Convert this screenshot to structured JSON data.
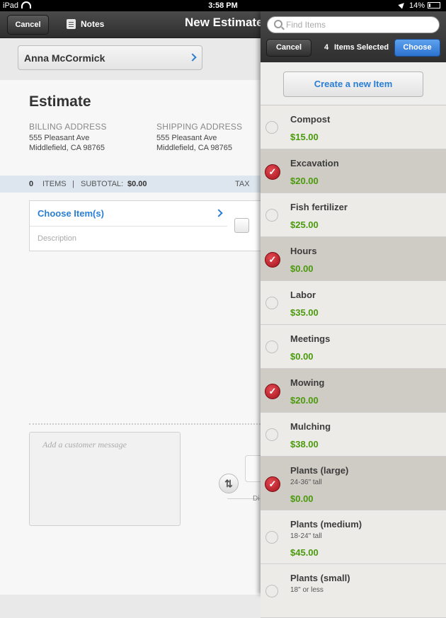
{
  "status": {
    "device": "iPad",
    "time": "3:58 PM",
    "battery": "14%"
  },
  "topbar": {
    "cancel_label": "Cancel",
    "notes_label": "Notes",
    "title": "New Estimate"
  },
  "customer": {
    "name": "Anna McCormick"
  },
  "estimate": {
    "title": "Estimate",
    "billing_label": "BILLING ADDRESS",
    "billing_line1": "555 Pleasant Ave",
    "billing_line2": "Middlefield, CA 98765",
    "shipping_label": "SHIPPING ADDRESS",
    "shipping_line1": "555 Pleasant Ave",
    "shipping_line2": "Middlefield, CA 98765"
  },
  "summary": {
    "item_count": "0",
    "items_label": "ITEMS",
    "separator": "|",
    "subtotal_label": "SUBTOTAL:",
    "subtotal_value": "$0.00",
    "tax_label": "TAX"
  },
  "line_item": {
    "choose_label": "Choose Item(s)",
    "description_placeholder": "Description"
  },
  "message": {
    "placeholder": "Add a customer message"
  },
  "partial_label": "Di",
  "picker": {
    "search_placeholder": "Find Items",
    "cancel_label": "Cancel",
    "selected_count": "4",
    "selected_label": "Items Selected",
    "choose_label": "Choose",
    "create_label": "Create a new Item",
    "items": [
      {
        "name": "Compost",
        "price": "$15.00",
        "selected": false
      },
      {
        "name": "Excavation",
        "price": "$20.00",
        "selected": true
      },
      {
        "name": "Fish fertilizer",
        "price": "$25.00",
        "selected": false
      },
      {
        "name": "Hours",
        "price": "$0.00",
        "selected": true
      },
      {
        "name": "Labor",
        "price": "$35.00",
        "selected": false
      },
      {
        "name": "Meetings",
        "price": "$0.00",
        "selected": false
      },
      {
        "name": "Mowing",
        "price": "$20.00",
        "selected": true
      },
      {
        "name": "Mulching",
        "price": "$38.00",
        "selected": false
      },
      {
        "name": "Plants (large)",
        "sub": "24-36\" tall",
        "price": "$0.00",
        "selected": true
      },
      {
        "name": "Plants (medium)",
        "sub": "18-24\" tall",
        "price": "$45.00",
        "selected": false
      },
      {
        "name": "Plants (small)",
        "sub": "18\" or less",
        "price": "",
        "selected": false
      }
    ]
  }
}
